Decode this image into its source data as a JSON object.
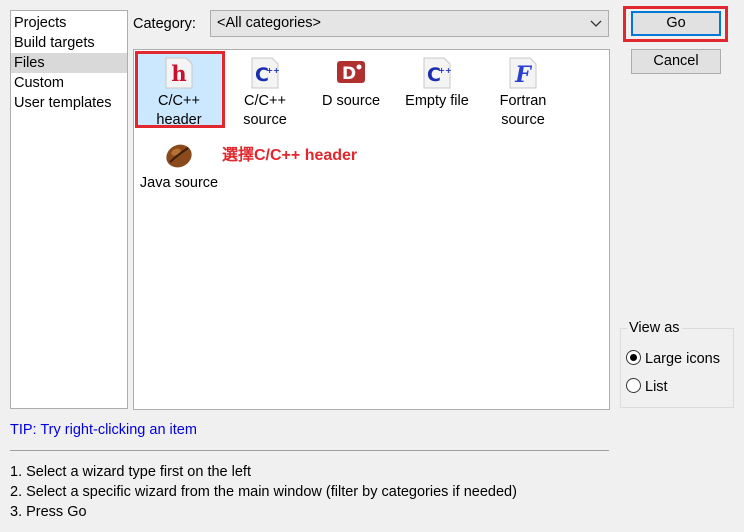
{
  "left_list": {
    "items": [
      {
        "label": "Projects",
        "selected": false
      },
      {
        "label": "Build targets",
        "selected": false
      },
      {
        "label": "Files",
        "selected": true
      },
      {
        "label": "Custom",
        "selected": false
      },
      {
        "label": "User templates",
        "selected": false
      }
    ]
  },
  "category": {
    "label": "Category:",
    "value": "<All categories>"
  },
  "wizards": [
    {
      "line1": "C/C++",
      "line2": "header",
      "icon": "c-cpp-header-icon",
      "selected": true
    },
    {
      "line1": "C/C++",
      "line2": "source",
      "icon": "c-cpp-source-icon",
      "selected": false
    },
    {
      "line1": "D source",
      "line2": "",
      "icon": "d-source-icon",
      "selected": false
    },
    {
      "line1": "Empty file",
      "line2": "",
      "icon": "empty-file-icon",
      "selected": false
    },
    {
      "line1": "Fortran",
      "line2": "source",
      "icon": "fortran-source-icon",
      "selected": false
    },
    {
      "line1": "Java source",
      "line2": "",
      "icon": "java-source-icon",
      "selected": false
    }
  ],
  "annotation": "選擇C/C++ header",
  "buttons": {
    "go": "Go",
    "cancel": "Cancel"
  },
  "view_as": {
    "title": "View as",
    "options": [
      {
        "label": "Large icons",
        "checked": true
      },
      {
        "label": "List",
        "checked": false
      }
    ]
  },
  "tip": "TIP: Try right-clicking an item",
  "instructions": [
    "1. Select a wizard type first on the left",
    "2. Select a specific wizard from the main window (filter by categories if needed)",
    "3. Press Go"
  ],
  "colors": {
    "highlight_red": "#e1282e",
    "tip_blue": "#0000e0",
    "selection_blue": "#cce8ff"
  }
}
